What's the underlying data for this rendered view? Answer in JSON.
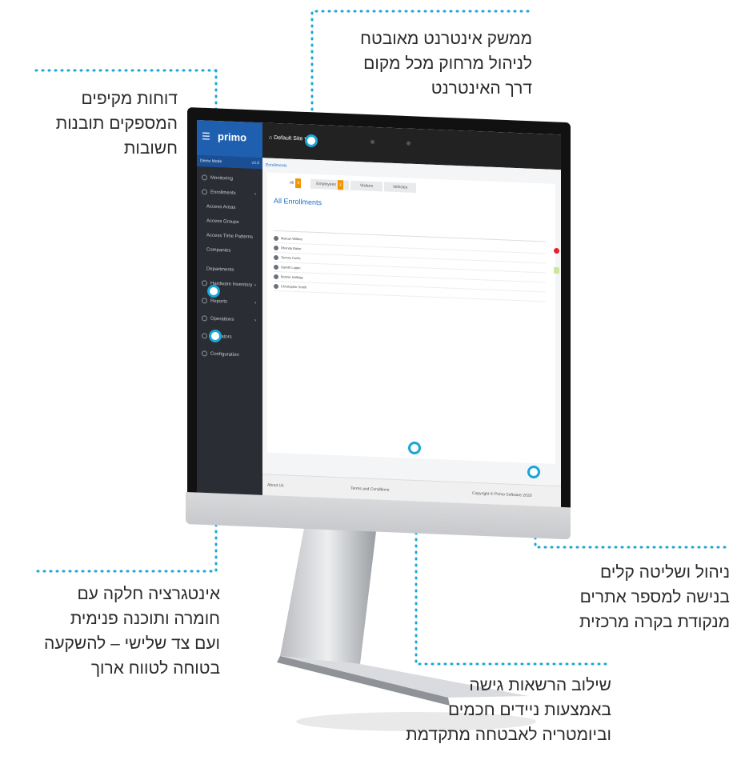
{
  "callouts": {
    "top_right": [
      "ממשק אינטרנט מאובטח",
      "לניהול מרחוק מכל מקום",
      "דרך האינטרנט"
    ],
    "top_left": [
      "דוחות מקיפים",
      "המספקים תובנות",
      "חשובות"
    ],
    "bottom_left": [
      "אינטגרציה חלקה עם",
      "חומרה ותוכנה פנימית",
      "ועם צד שלישי – להשקעה",
      "בטוחה לטווח ארוך"
    ],
    "middle_right": [
      "ניהול ושליטה קלים",
      "בנישה למספר אתרים",
      "מנקודת בקרה מרכזית"
    ],
    "bottom_center": [
      "שילוב הרשאות גישה",
      "באמצעות ניידים חכמים",
      "וביומטריה לאבטחה מתקדמת"
    ]
  },
  "colors": {
    "accent": "#1aa6d6",
    "sidebar": "#2a2d33",
    "brand_blue": "#1f5fb0"
  },
  "app": {
    "brand": "primo",
    "site_selector": "Default Site",
    "sidebar_sub": "Demo Mode",
    "sidebar_sub_right": "v3.0",
    "nav": [
      "Monitoring",
      "Enrollments",
      "Access Areas",
      "Access Groups",
      "Access Time Patterns",
      "Companies",
      "Departments",
      "Hardware Inventory",
      "Reports",
      "Operations",
      "Operators",
      "Configuration"
    ],
    "breadcrumb": "Enrollments",
    "tabs": [
      "All",
      "Employees",
      "Visitors",
      "Vehicles"
    ],
    "tab_badges": [
      "8",
      "2"
    ],
    "page_title": "All Enrollments",
    "rows": [
      "Marcus Wilkins",
      "Rhonda Baker",
      "Tommy Curtis",
      "Gareth Logan",
      "Bonnie Holliday",
      "Christopher Smith"
    ],
    "footer": [
      "About Us",
      "Terms and Conditions",
      "Copyright © Primo Software 2020"
    ]
  }
}
